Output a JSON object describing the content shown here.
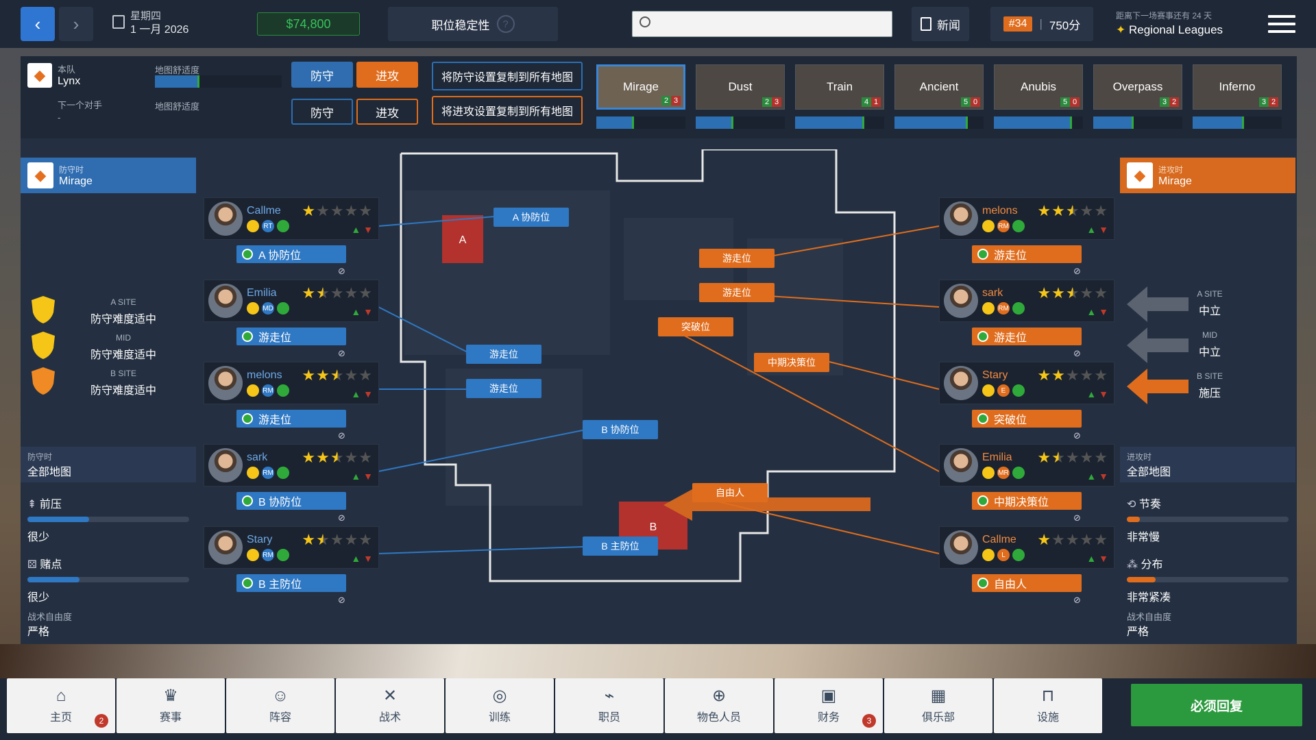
{
  "topbar": {
    "weekday": "星期四",
    "date": "1 一月 2026",
    "money": "$74,800",
    "stability_label": "职位稳定性",
    "stability_help": "?",
    "search_placeholder": "",
    "news_label": "新闻",
    "rank": "#34",
    "points": "750分",
    "next_match_label": "距离下一场赛事还有 24 天",
    "next_league": "Regional Leagues"
  },
  "team": {
    "our_label": "本队",
    "our_name": "Lynx",
    "map_comfort_label": "地图舒适度",
    "our_comfort": 0.35,
    "next_opp_label": "下一个对手",
    "next_opp_name": "-",
    "opp_map_comfort_label": "地图舒适度",
    "defense_label": "防守",
    "attack_label": "进攻",
    "copy_defense": "将防守设置复制到所有地图",
    "copy_attack": "将进攻设置复制到所有地图"
  },
  "maps": [
    {
      "name": "Mirage",
      "w": "2",
      "l": "3",
      "comfort": 0.42,
      "selected": true
    },
    {
      "name": "Dust",
      "w": "2",
      "l": "3",
      "comfort": 0.42
    },
    {
      "name": "Train",
      "w": "4",
      "l": "1",
      "comfort": 0.78
    },
    {
      "name": "Ancient",
      "w": "5",
      "l": "0",
      "comfort": 0.82
    },
    {
      "name": "Anubis",
      "w": "5",
      "l": "0",
      "comfort": 0.88
    },
    {
      "name": "Overpass",
      "w": "3",
      "l": "2",
      "comfort": 0.45
    },
    {
      "name": "Inferno",
      "w": "3",
      "l": "2",
      "comfort": 0.58
    }
  ],
  "defense": {
    "header_small": "防守时",
    "header_map": "Mirage",
    "sites": [
      {
        "site": "A SITE",
        "difficulty": "防守难度适中",
        "color": "#f5c518"
      },
      {
        "site": "MID",
        "difficulty": "防守难度适中",
        "color": "#f5c518"
      },
      {
        "site": "B SITE",
        "difficulty": "防守难度适中",
        "color": "#f08a24"
      }
    ],
    "scope_small": "防守时",
    "scope": "全部地图",
    "press_label": "前压",
    "press_value": "很少",
    "press_level": 0.38,
    "gamble_label": "赌点",
    "gamble_value": "很少",
    "gamble_level": 0.32,
    "freedom_label": "战术自由度",
    "freedom_value": "严格"
  },
  "attack": {
    "header_small": "进攻时",
    "header_map": "Mirage",
    "sites": [
      {
        "site": "A SITE",
        "tendency": "中立"
      },
      {
        "site": "MID",
        "tendency": "中立"
      },
      {
        "site": "B SITE",
        "tendency": "施压"
      }
    ],
    "scope_small": "进攻时",
    "scope": "全部地图",
    "tempo_label": "节奏",
    "tempo_value": "非常慢",
    "tempo_level": 0.08,
    "spread_label": "分布",
    "spread_value": "非常紧凑",
    "spread_level": 0.18,
    "freedom_label": "战术自由度",
    "freedom_value": "严格"
  },
  "def_players": [
    {
      "name": "Callme",
      "stars": 1,
      "role": "A 协防位",
      "ic": [
        "RT"
      ]
    },
    {
      "name": "Emilia",
      "stars": 1.5,
      "role": "游走位",
      "ic": [
        "MD"
      ]
    },
    {
      "name": "melons",
      "stars": 2.5,
      "role": "游走位",
      "ic": [
        "RM"
      ]
    },
    {
      "name": "sark",
      "stars": 2.5,
      "role": "B 协防位",
      "ic": [
        "RM"
      ]
    },
    {
      "name": "Stary",
      "stars": 1.5,
      "role": "B 主防位",
      "ic": [
        "RM"
      ]
    }
  ],
  "att_players": [
    {
      "name": "melons",
      "stars": 2.5,
      "role": "游走位",
      "ic": [
        "RM"
      ]
    },
    {
      "name": "sark",
      "stars": 2.5,
      "role": "游走位",
      "ic": [
        "RM"
      ]
    },
    {
      "name": "Stary",
      "stars": 2,
      "role": "突破位",
      "ic": [
        "E"
      ]
    },
    {
      "name": "Emilia",
      "stars": 1.5,
      "role": "中期决策位",
      "ic": [
        "MR"
      ]
    },
    {
      "name": "Callme",
      "stars": 1,
      "role": "自由人",
      "ic": [
        "L"
      ]
    }
  ],
  "map_tags": {
    "site_a": "A",
    "site_b": "B",
    "def": [
      "A 协防位",
      "游走位",
      "游走位",
      "B 协防位",
      "B 主防位"
    ],
    "att": [
      "游走位",
      "游走位",
      "突破位",
      "中期决策位",
      "自由人"
    ]
  },
  "nav": [
    {
      "label": "主页",
      "icon": "home-icon",
      "badge": "2"
    },
    {
      "label": "赛事",
      "icon": "trophy-icon"
    },
    {
      "label": "阵容",
      "icon": "roster-icon"
    },
    {
      "label": "战术",
      "icon": "tactics-icon"
    },
    {
      "label": "训练",
      "icon": "target-icon"
    },
    {
      "label": "职员",
      "icon": "whistle-icon"
    },
    {
      "label": "物色人员",
      "icon": "scout-icon"
    },
    {
      "label": "财务",
      "icon": "money-icon",
      "badge": "3"
    },
    {
      "label": "俱乐部",
      "icon": "building-icon"
    },
    {
      "label": "设施",
      "icon": "facility-icon"
    }
  ],
  "continue": "必须回复"
}
